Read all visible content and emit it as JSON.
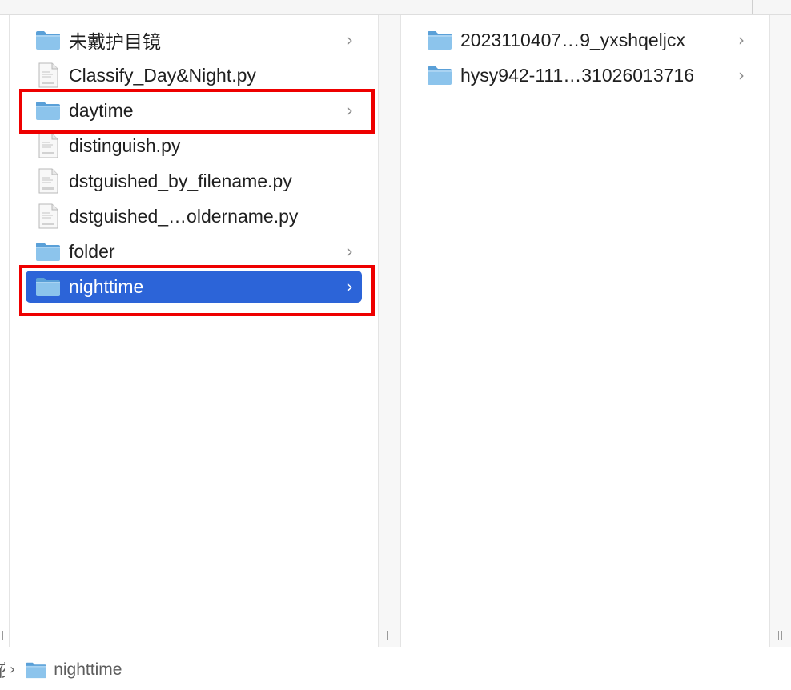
{
  "left_column": {
    "items": [
      {
        "label": "未戴护目镜",
        "kind": "folder",
        "icon": "folder-icon",
        "has_children": true,
        "chevron": "›"
      },
      {
        "label": "Classify_Day&Night.py",
        "kind": "file",
        "icon": "python-file-icon",
        "has_children": false
      },
      {
        "label": "daytime",
        "kind": "folder",
        "icon": "folder-icon",
        "has_children": true,
        "chevron": "›"
      },
      {
        "label": "distinguish.py",
        "kind": "file",
        "icon": "python-file-icon",
        "has_children": false
      },
      {
        "label": "dstguished_by_filename.py",
        "kind": "file",
        "icon": "python-file-icon",
        "has_children": false
      },
      {
        "label": "dstguished_…oldername.py",
        "kind": "file",
        "icon": "python-file-icon",
        "has_children": false
      },
      {
        "label": "folder",
        "kind": "folder",
        "icon": "folder-icon",
        "has_children": true,
        "chevron": "›"
      },
      {
        "label": "nighttime",
        "kind": "folder",
        "icon": "folder-icon",
        "has_children": true,
        "chevron": "›",
        "selected": true
      }
    ]
  },
  "right_column": {
    "items": [
      {
        "label": "2023110407…9_yxshqeljcx",
        "kind": "folder",
        "icon": "folder-icon",
        "has_children": true,
        "chevron": "›"
      },
      {
        "label": "hysy942-111…31026013716",
        "kind": "folder",
        "icon": "folder-icon",
        "has_children": true,
        "chevron": "›"
      }
    ]
  },
  "path_bar": {
    "truncated_parent": "夜",
    "separator": "›",
    "current": "nighttime",
    "current_icon": "folder-icon"
  },
  "highlights": [
    "daytime",
    "nighttime"
  ],
  "colors": {
    "selection": "#2c64d8",
    "highlight_box": "#ee0000",
    "folder_light": "#8cc4ec",
    "folder_dark": "#5aa0d8"
  }
}
